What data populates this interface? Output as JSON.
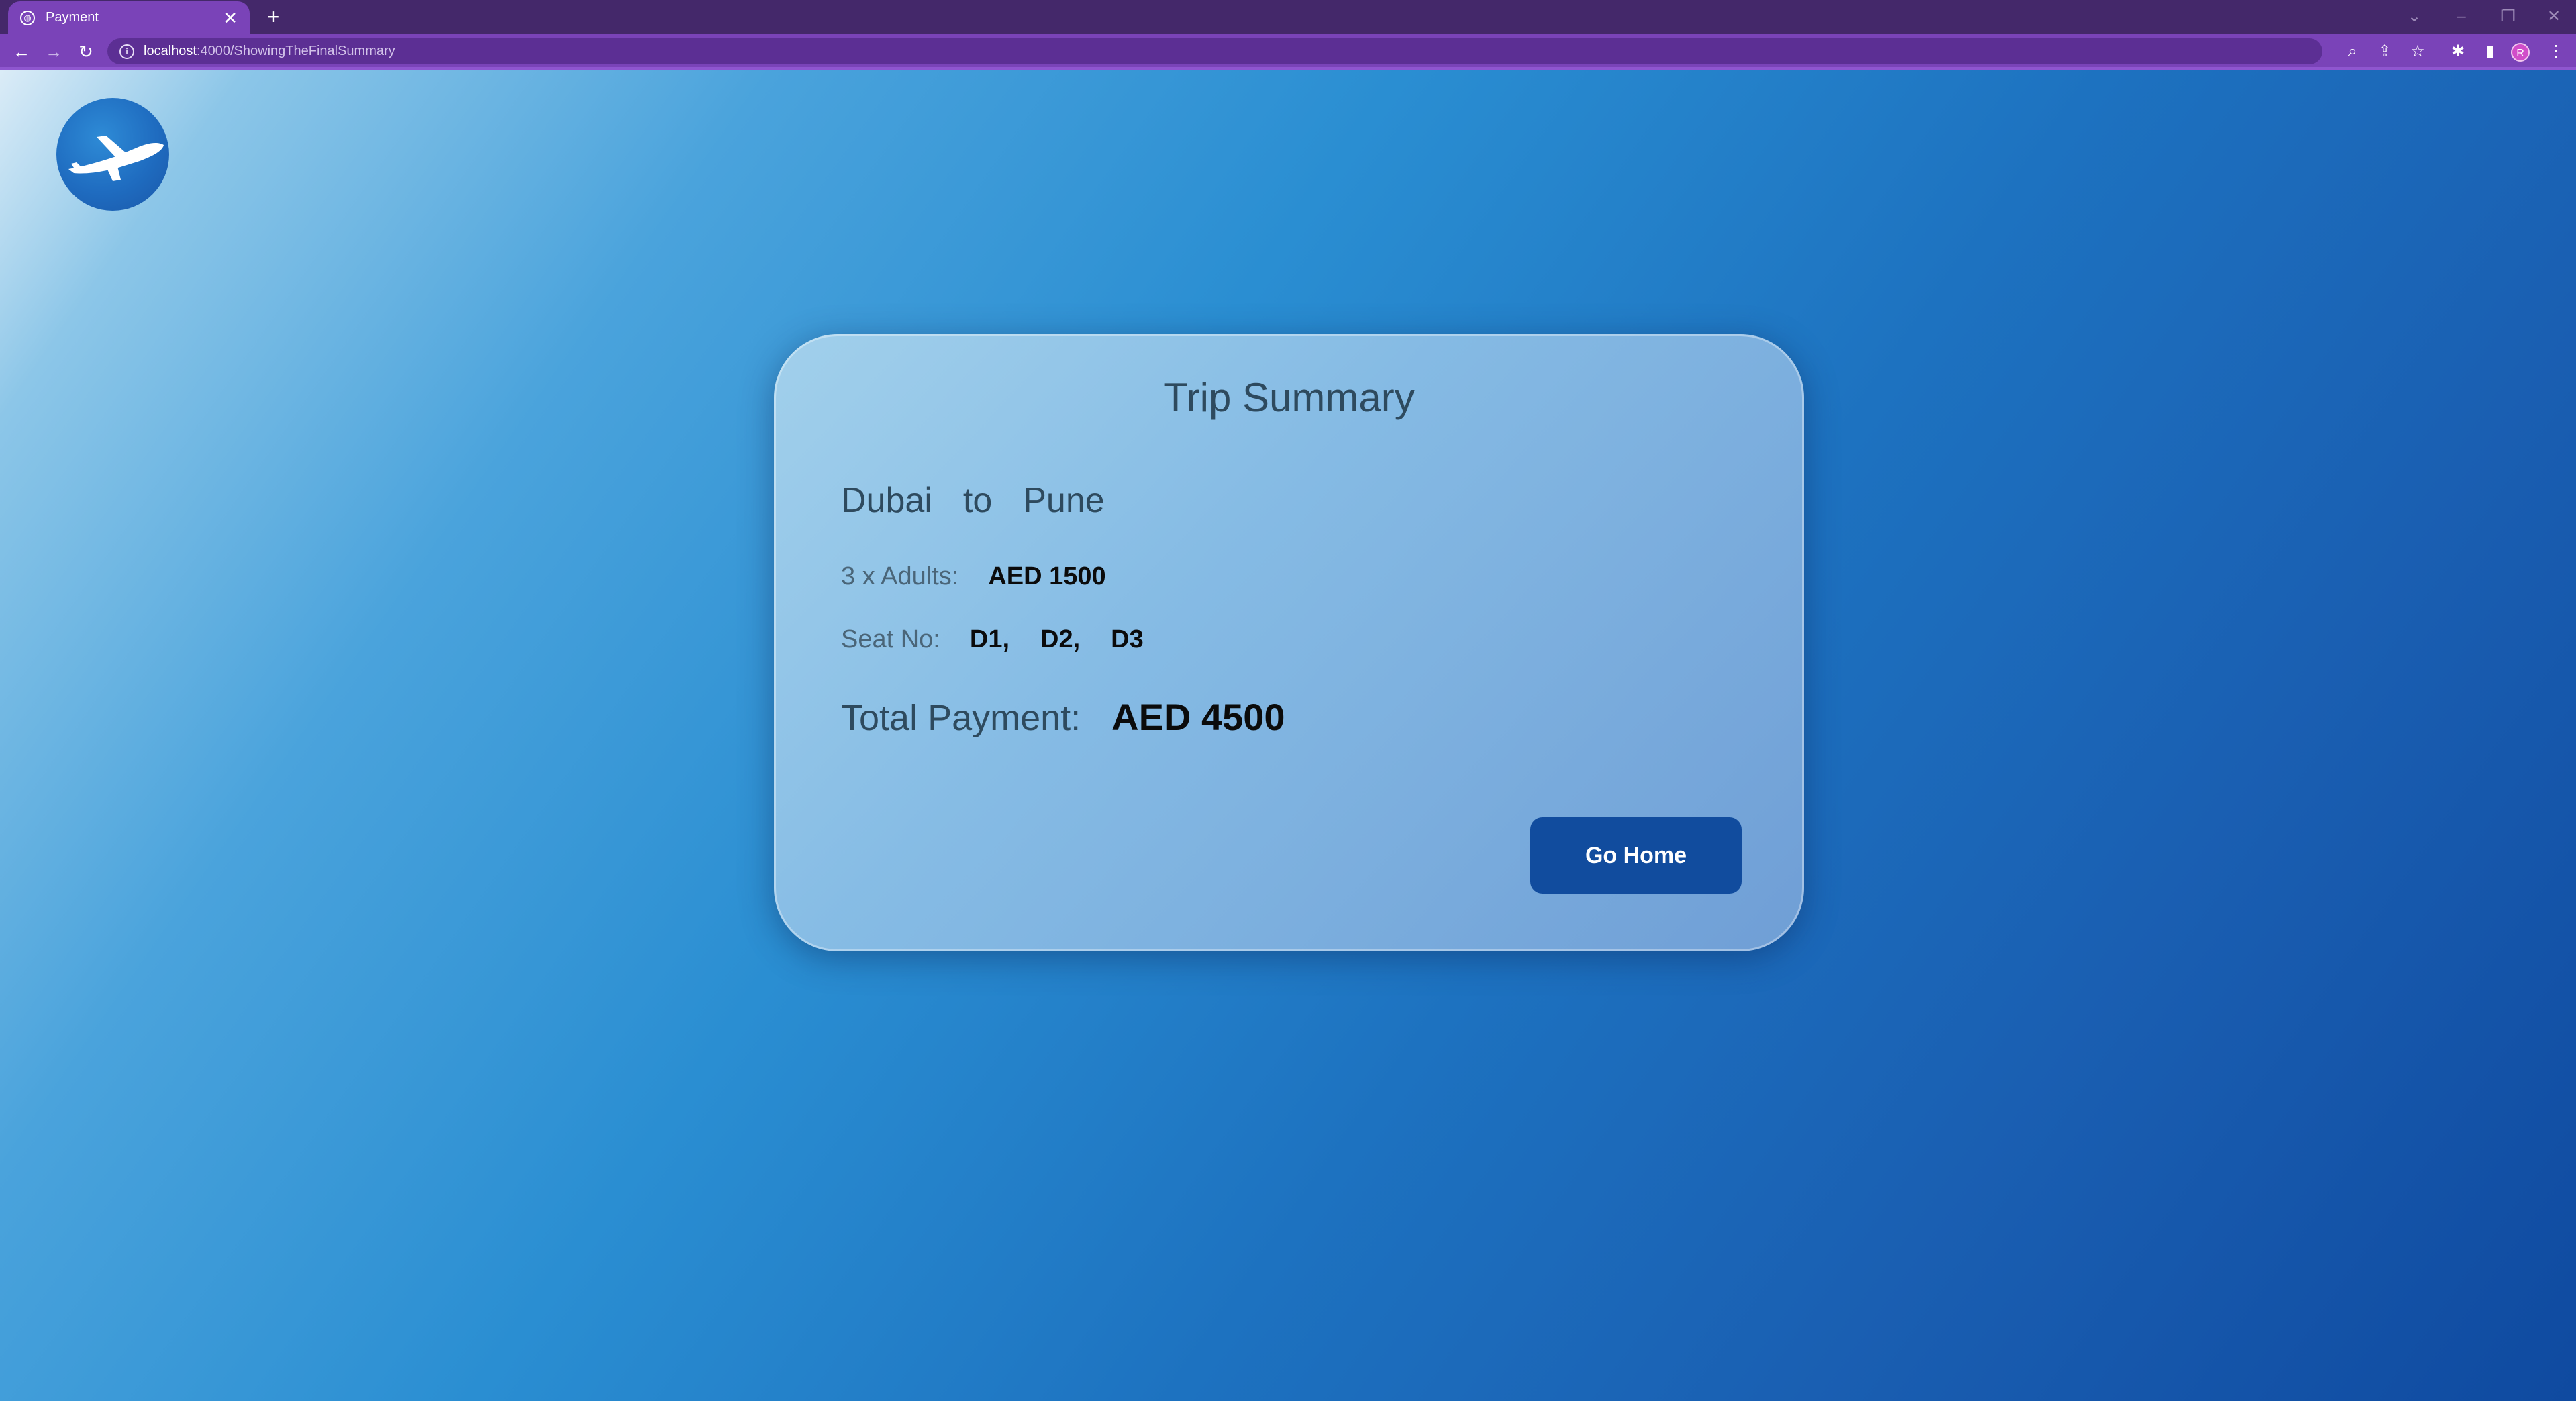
{
  "browser": {
    "tab_title": "Payment",
    "tab_close": "✕",
    "new_tab": "+",
    "url_host": "localhost",
    "url_path": ":4000/ShowingTheFinalSummary",
    "profile_initial": "R"
  },
  "card": {
    "title": "Trip Summary",
    "from": "Dubai",
    "connector": "to",
    "to": "Pune",
    "adults_label": "3 x Adults:",
    "adults_price": "AED 1500",
    "seat_label": "Seat No:",
    "seats": [
      "D1,",
      "D2,",
      "D3"
    ],
    "total_label": "Total Payment:",
    "total_value": "AED 4500",
    "button_label": "Go Home"
  },
  "colors": {
    "chrome": "#44286a",
    "toolbar": "#7a43b8",
    "button": "#114c9e"
  }
}
